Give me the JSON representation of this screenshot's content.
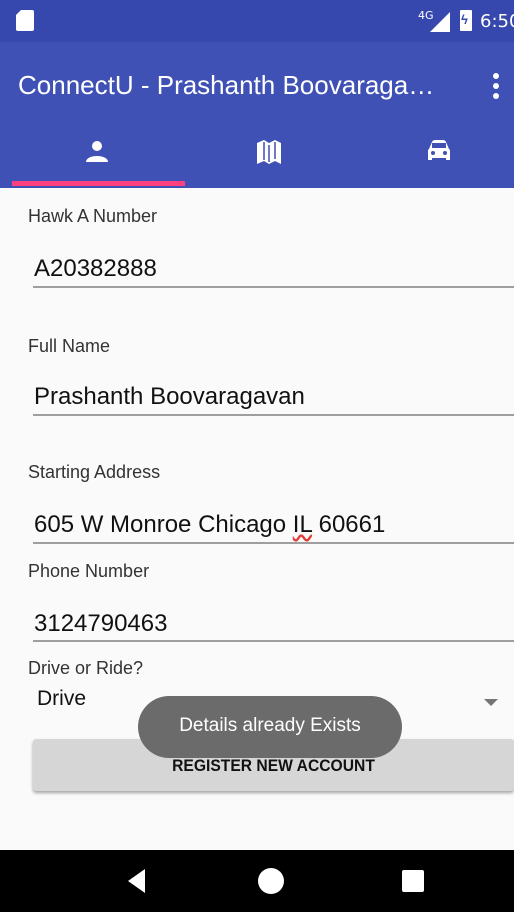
{
  "status_bar": {
    "network": "4G",
    "time": "6:50",
    "icons": [
      "sd-card-icon",
      "signal-icon",
      "battery-charging-icon"
    ]
  },
  "app_bar": {
    "title": "ConnectU - Prashanth Boovaraga…",
    "overflow_icon": "more-vert-icon"
  },
  "tabs": [
    {
      "icon": "person-icon",
      "selected": true
    },
    {
      "icon": "map-icon",
      "selected": false
    },
    {
      "icon": "car-icon",
      "selected": false
    }
  ],
  "form": {
    "hawk_label": "Hawk A Number",
    "hawk_value": "A20382888",
    "name_label": "Full Name",
    "name_value": "Prashanth Boovaragavan",
    "address_label": "Starting Address",
    "address_value_before": "605 W Monroe Chicago ",
    "address_value_flagged": "IL",
    "address_value_after": " 60661",
    "phone_label": "Phone Number",
    "phone_value": "3124790463",
    "mode_label": "Drive or Ride?",
    "mode_value": "Drive"
  },
  "register_button": "REGISTER NEW ACCOUNT",
  "toast": "Details already Exists",
  "colors": {
    "primary": "#3f51b5",
    "primary_dark": "#3647ad",
    "accent": "#ff4081"
  }
}
